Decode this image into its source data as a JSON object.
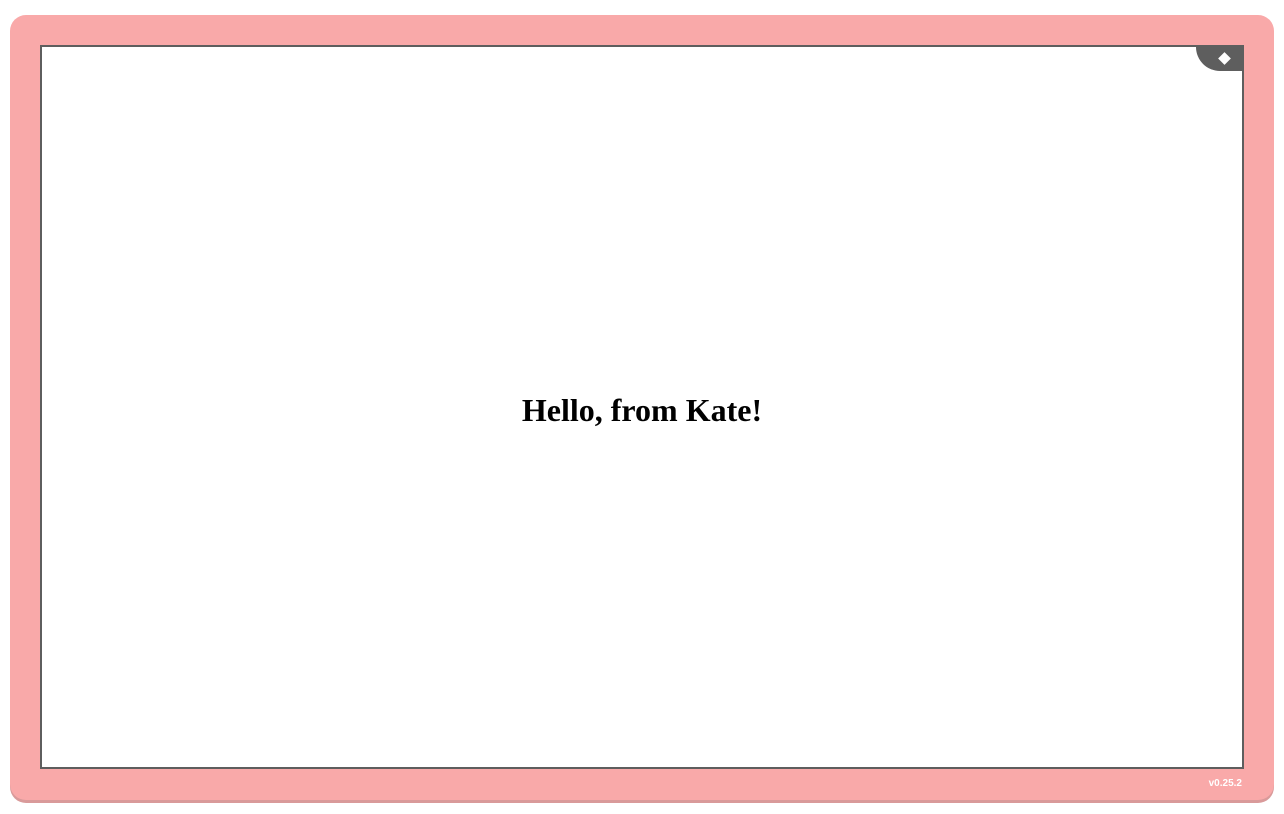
{
  "app": {
    "greeting": "Hello, from Kate!",
    "version": "v0.25.2"
  },
  "corner_button": {
    "icon": "diamond-icon"
  },
  "colors": {
    "frame": "#f9a9a9",
    "stage_border": "#5e5e5e",
    "stage_background": "#ffffff",
    "text": "#000000"
  }
}
